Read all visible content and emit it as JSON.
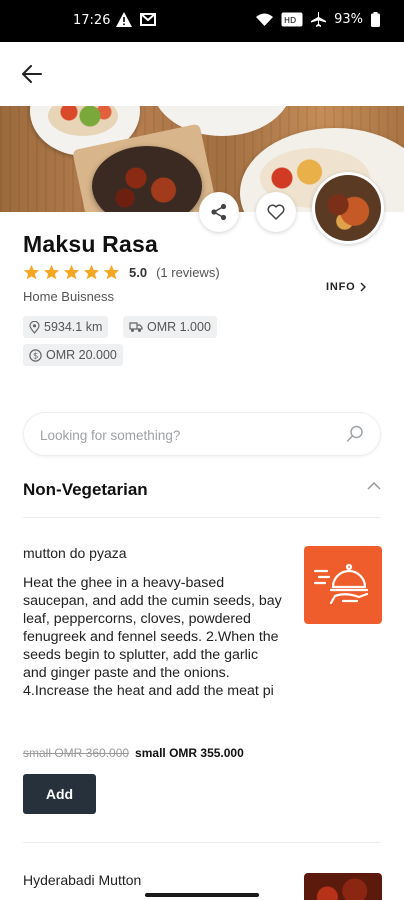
{
  "status_bar": {
    "time": "17:26",
    "battery": "93%",
    "icons": [
      "warning-icon",
      "gmail-icon",
      "wifi-icon",
      "hd-icon",
      "airplane-icon",
      "battery-icon"
    ]
  },
  "restaurant": {
    "name": "Maksu Rasa",
    "rating": "5.0",
    "reviews": "(1 reviews)",
    "stars_filled": 5,
    "type": "Home Buisness",
    "info_label": "INFO",
    "distance": "5934.1 km",
    "delivery_fee": "OMR 1.000",
    "min_order": "OMR 20.000"
  },
  "search": {
    "placeholder": "Looking for something?"
  },
  "category": {
    "title": "Non-Vegetarian"
  },
  "items": [
    {
      "name": "mutton do pyaza",
      "description": "Heat the ghee in a heavy-based saucepan, and add the cumin seeds, bay leaf, peppercorns, cloves, powdered fenugreek and fennel seeds. 2.When the seeds begin to splutter, add the garlic and ginger paste and the onions. 4.Increase the heat and add the meat pi",
      "old_price": "small OMR 360.000",
      "new_price": "small OMR 355.000",
      "add_label": "Add"
    },
    {
      "name": "Hyderabadi Mutton"
    }
  ],
  "colors": {
    "accent": "#f05d2d",
    "star": "#f5a623",
    "button": "#27313b"
  }
}
